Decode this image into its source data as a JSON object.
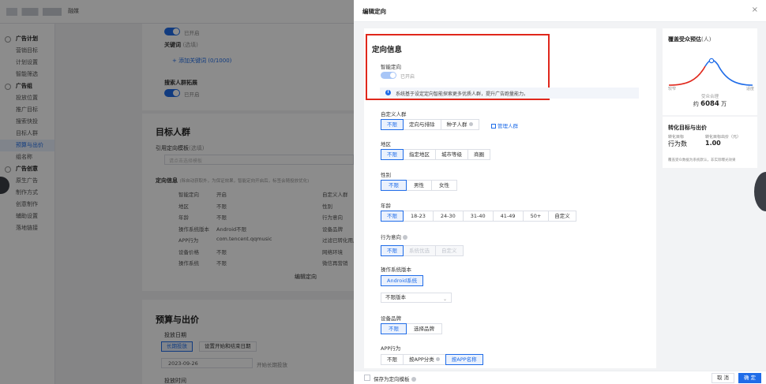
{
  "background": {
    "brand_label": "融媒",
    "sidebar": [
      {
        "type": "group",
        "label": "广告计划"
      },
      {
        "type": "item",
        "label": "营销目标"
      },
      {
        "type": "item",
        "label": "计划设置"
      },
      {
        "type": "item",
        "label": "智能筛选"
      },
      {
        "type": "group",
        "label": "广告组"
      },
      {
        "type": "item",
        "label": "投放位置"
      },
      {
        "type": "item",
        "label": "推广目标"
      },
      {
        "type": "item",
        "label": "搜索快投"
      },
      {
        "type": "item",
        "label": "目标人群"
      },
      {
        "type": "item",
        "label": "预算与出价",
        "active": true
      },
      {
        "type": "item",
        "label": "组名称"
      },
      {
        "type": "group",
        "label": "广告创意"
      },
      {
        "type": "item",
        "label": "原生广告"
      },
      {
        "type": "item",
        "label": "制作方式"
      },
      {
        "type": "item",
        "label": "创意制作"
      },
      {
        "type": "item",
        "label": "辅助设置"
      },
      {
        "type": "item",
        "label": "落地链接"
      }
    ],
    "toggle1_text": "已开启",
    "keyword_label": "关键词",
    "keyword_hint": "(选填)",
    "add_keyword": "+ 添加关键词 (0/1000)",
    "search_expand_label": "搜索人群拓展",
    "toggle2_text": "已开启",
    "target_title": "目标人群",
    "template_label": "引用定向模板",
    "template_hint": "(选填)",
    "template_placeholder": "请点击选择模板",
    "info_label": "定向信息",
    "info_hint": "(除自动获取外，为保证效果，智能定向开启后，标签会随投放优化)",
    "rows": [
      {
        "k": "智能定向",
        "v": "开启",
        "k2": "自定义人群"
      },
      {
        "k": "地区",
        "v": "不限",
        "k2": "性别"
      },
      {
        "k": "年龄",
        "v": "不限",
        "k2": "行为意向"
      },
      {
        "k": "操作系统版本",
        "v": "Android不限",
        "k2": "设备品牌"
      },
      {
        "k": "APP行为",
        "v": "com.tencent.qqmusic",
        "k2": "过滤已转化用户"
      },
      {
        "k": "设备价格",
        "v": "不限",
        "k2": "网络环境"
      },
      {
        "k": "操作系统",
        "v": "不限",
        "k2": "微信再营销"
      }
    ],
    "edit_targeting": "编辑定向",
    "budget_title": "预算与出价",
    "schedule_label": "投放日期",
    "schedule_opt1": "长期投放",
    "schedule_opt2": "设置开始和结束日期",
    "date_value": "2023-09-26",
    "date_suffix": "开始长期投放",
    "time_label": "投放时间"
  },
  "drawer": {
    "title": "编辑定向",
    "close": "×",
    "section_title": "定向信息",
    "smart_label": "智能定向",
    "smart_state": "已开启",
    "info_text": "系统基于设定定向智能探索更多优质人群，提升广告跑量能力。",
    "custom_audience": {
      "label": "自定义人群",
      "options": [
        "不限",
        "定向与排除",
        "种子人群"
      ],
      "selected": 0,
      "manage": "管理人群"
    },
    "region": {
      "label": "地区",
      "options": [
        "不限",
        "指定地区",
        "城市等级",
        "商圈"
      ],
      "selected": 0
    },
    "gender": {
      "label": "性别",
      "options": [
        "不限",
        "男性",
        "女性"
      ],
      "selected": 0
    },
    "age": {
      "label": "年龄",
      "options": [
        "不限",
        "18-23",
        "24-30",
        "31-40",
        "41-49",
        "50+",
        "自定义"
      ],
      "selected": 0
    },
    "behavior": {
      "label": "行为意向",
      "options": [
        "不限",
        "系统优选",
        "自定义"
      ],
      "selected": 0
    },
    "os_version": {
      "label": "操作系统版本",
      "tab": "Android系统",
      "select_value": "不限版本"
    },
    "brand": {
      "label": "设备品牌",
      "options": [
        "不限",
        "选择品牌"
      ],
      "selected": 0
    },
    "app_behavior": {
      "label": "APP行为",
      "options": [
        "不限",
        "按APP分类",
        "按APP名称"
      ],
      "selected": 2
    },
    "footer": {
      "save_template": "保存为定向模板",
      "cancel": "取 消",
      "ok": "确 定"
    }
  },
  "estimate": {
    "title": "覆盖受众预估",
    "unit": "(人)",
    "left_label": "较窄",
    "right_label": "适度",
    "sub": "受众合理",
    "value_prefix": "约",
    "value": "6084",
    "value_suffix": "万"
  },
  "bid": {
    "title": "转化目标与出价",
    "k1": "转化目标",
    "k2": "转化目标出价（元）",
    "v1": "行为数",
    "v2": "1.00",
    "note": "覆盖受众数据为系统默认，非实际曝光效果"
  },
  "colors": {
    "accent": "#1f6ce8",
    "highlight": "#e0271b",
    "curve_left": "#e0271b",
    "curve_right": "#1f6ce8"
  }
}
